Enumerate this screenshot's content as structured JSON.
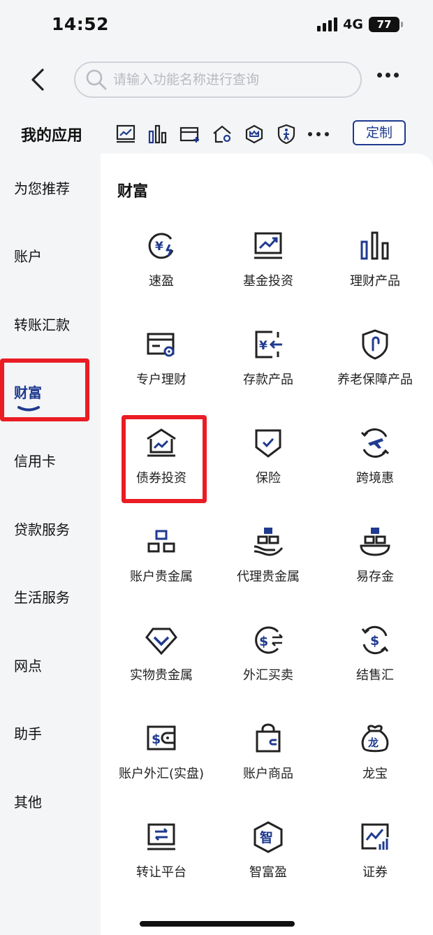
{
  "status_bar": {
    "time": "14:52",
    "network": "4G",
    "battery": "77"
  },
  "search": {
    "placeholder": "请输入功能名称进行查询"
  },
  "my_apps": {
    "title": "我的应用",
    "custom_label": "定制",
    "icons": [
      "chart-icon",
      "bars-icon",
      "card-add-icon",
      "house-location-icon",
      "crown-shield-icon",
      "person-shield-icon",
      "more-dots-icon"
    ]
  },
  "sidebar": {
    "items": [
      {
        "label": "为您推荐"
      },
      {
        "label": "账户"
      },
      {
        "label": "转账汇款"
      },
      {
        "label": "财富",
        "active": true
      },
      {
        "label": "信用卡"
      },
      {
        "label": "贷款服务"
      },
      {
        "label": "生活服务"
      },
      {
        "label": "网点"
      },
      {
        "label": "助手"
      },
      {
        "label": "其他"
      }
    ]
  },
  "section": {
    "title": "财富",
    "items": [
      {
        "label": "速盈",
        "icon": "yen-lightning-icon"
      },
      {
        "label": "基金投资",
        "icon": "monitor-chart-icon"
      },
      {
        "label": "理财产品",
        "icon": "bars-icon"
      },
      {
        "label": "专户理财",
        "icon": "card-lock-icon"
      },
      {
        "label": "存款产品",
        "icon": "yen-deposit-icon"
      },
      {
        "label": "养老保障产品",
        "icon": "shield-cane-icon"
      },
      {
        "label": "债券投资",
        "icon": "bank-chart-icon"
      },
      {
        "label": "保险",
        "icon": "shield-check-icon"
      },
      {
        "label": "跨境惠",
        "icon": "plane-globe-icon"
      },
      {
        "label": "账户贵金属",
        "icon": "gold-bars-icon"
      },
      {
        "label": "代理贵金属",
        "icon": "gold-hand-icon"
      },
      {
        "label": "易存金",
        "icon": "gold-bowl-icon"
      },
      {
        "label": "实物贵金属",
        "icon": "diamond-icon"
      },
      {
        "label": "外汇买卖",
        "icon": "dollar-exchange-icon"
      },
      {
        "label": "结售汇",
        "icon": "dollar-cycle-icon"
      },
      {
        "label": "账户外汇(实盘)",
        "icon": "dollar-wallet-icon"
      },
      {
        "label": "账户商品",
        "icon": "bag-icon"
      },
      {
        "label": "龙宝",
        "icon": "dragon-bag-icon"
      },
      {
        "label": "转让平台",
        "icon": "transfer-screen-icon"
      },
      {
        "label": "智富盈",
        "icon": "hexagon-zhi-icon"
      },
      {
        "label": "证券",
        "icon": "stock-chart-icon"
      }
    ]
  },
  "colors": {
    "accent": "#1f3a8f",
    "highlight": "#ea1c24"
  }
}
